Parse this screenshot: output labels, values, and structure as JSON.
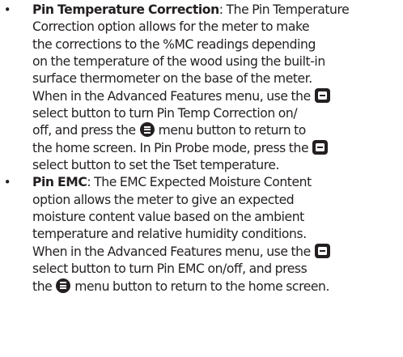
{
  "items": [
    {
      "bullet": "•",
      "term": "Pin Temperature Correction",
      "separator": ":",
      "text": [
        "The Pin Temperature",
        "Correction option allows for the meter to make",
        "the corrections to the %MC readings depending",
        "on the temperature of the wood using the built-in",
        "surface thermometer on the base of the meter.",
        "When in the Advanced Features menu, use the",
        "select button to turn Pin Temp Correction on/",
        "off, and press the",
        "menu button to return to",
        "the home screen. In Pin Probe mode, press the",
        "select button to set the Tset temperature."
      ]
    },
    {
      "bullet": "•",
      "term": "Pin EMC",
      "separator": ":",
      "text": [
        "The EMC Expected Moisture Content",
        "option allows the meter to give an expected",
        "moisture content value based on the ambient",
        "temperature and relative humidity conditions.",
        "When in the Advanced Features menu, use the",
        "select button to turn Pin EMC on/off, and press",
        "the",
        "menu button to return to the home screen."
      ]
    }
  ],
  "icons": {
    "select": "select-button-icon",
    "menu": "menu-button-icon"
  }
}
